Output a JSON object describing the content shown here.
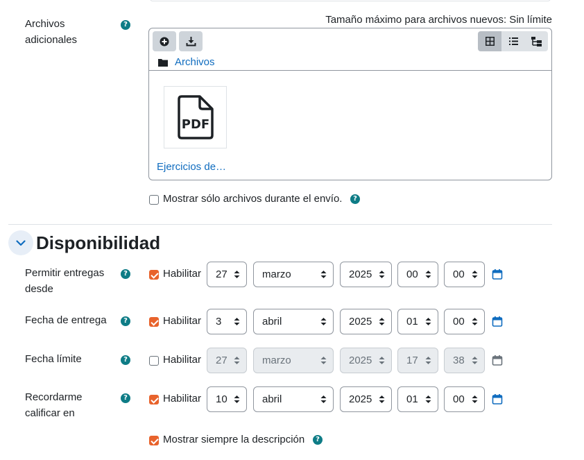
{
  "files": {
    "label": "Archivos adicionales",
    "max_size": "Tamaño máximo para archivos nuevos: Sin límite",
    "breadcrumb": "Archivos",
    "file_name": "Ejercicios de…",
    "file_type_text": "PDF",
    "toolbar_icons": [
      "add-file-icon",
      "download-icon"
    ],
    "view_icons": [
      "grid-view-icon",
      "list-view-icon",
      "tree-view-icon"
    ],
    "show_only_files": {
      "label": "Mostrar sólo archivos durante el envío.",
      "checked": false
    }
  },
  "availability": {
    "title": "Disponibilidad",
    "enable_label": "Habilitar",
    "rows": [
      {
        "label": "Permitir entregas desde",
        "enabled": true,
        "day": "27",
        "month": "marzo",
        "year": "2025",
        "hour": "00",
        "minute": "00"
      },
      {
        "label": "Fecha de entrega",
        "enabled": true,
        "day": "3",
        "month": "abril",
        "year": "2025",
        "hour": "01",
        "minute": "00"
      },
      {
        "label": "Fecha límite",
        "enabled": false,
        "day": "27",
        "month": "marzo",
        "year": "2025",
        "hour": "17",
        "minute": "38"
      },
      {
        "label": "Recordarme calificar en",
        "enabled": true,
        "day": "10",
        "month": "abril",
        "year": "2025",
        "hour": "01",
        "minute": "00"
      }
    ],
    "always_show_description": {
      "label": "Mostrar siempre la descripción",
      "checked": true
    }
  },
  "help_glyph": "?",
  "colors": {
    "accent": "#0f6cbf",
    "checkbox": "#e8632c",
    "help": "#0e7c86"
  }
}
